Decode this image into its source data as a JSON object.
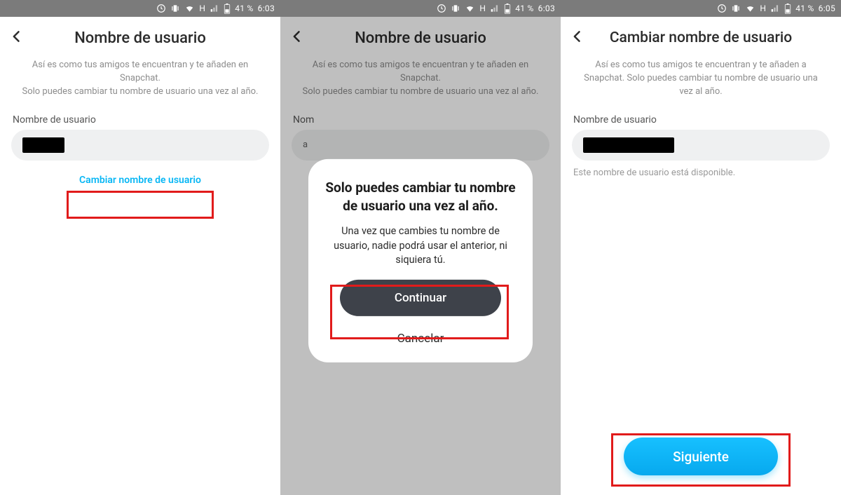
{
  "status": {
    "network_label": "H",
    "battery_pct": "41 %",
    "time_a": "6:03",
    "time_b": "6:03",
    "time_c": "6:05"
  },
  "screen1": {
    "title": "Nombre de usuario",
    "desc_line1": "Así es como tus amigos te encuentran y te añaden en Snapchat.",
    "desc_line2": "Solo puedes cambiar tu nombre de usuario una vez al año.",
    "field_label": "Nombre de usuario",
    "change_link": "Cambiar nombre de usuario"
  },
  "screen2": {
    "title": "Nombre de usuario",
    "desc_line1": "Así es como tus amigos te encuentran y te añaden en Snapchat.",
    "desc_line2": "Solo puedes cambiar tu nombre de usuario una vez al año.",
    "field_label_prefix": "Nom",
    "field_value_prefix": "a",
    "modal": {
      "heading": "Solo puedes cambiar tu nombre de usuario una vez al año.",
      "body": "Una vez que cambies tu nombre de usuario, nadie podrá usar el anterior, ni siquiera tú.",
      "continue": "Continuar",
      "cancel": "Cancelar"
    }
  },
  "screen3": {
    "title": "Cambiar nombre de usuario",
    "desc_line1": "Así es como tus amigos te encuentran y te añaden a Snapchat. Solo puedes cambiar tu nombre de usuario una vez al año.",
    "field_label": "Nombre de usuario",
    "helper": "Este nombre de usuario está disponible.",
    "cta": "Siguiente"
  }
}
